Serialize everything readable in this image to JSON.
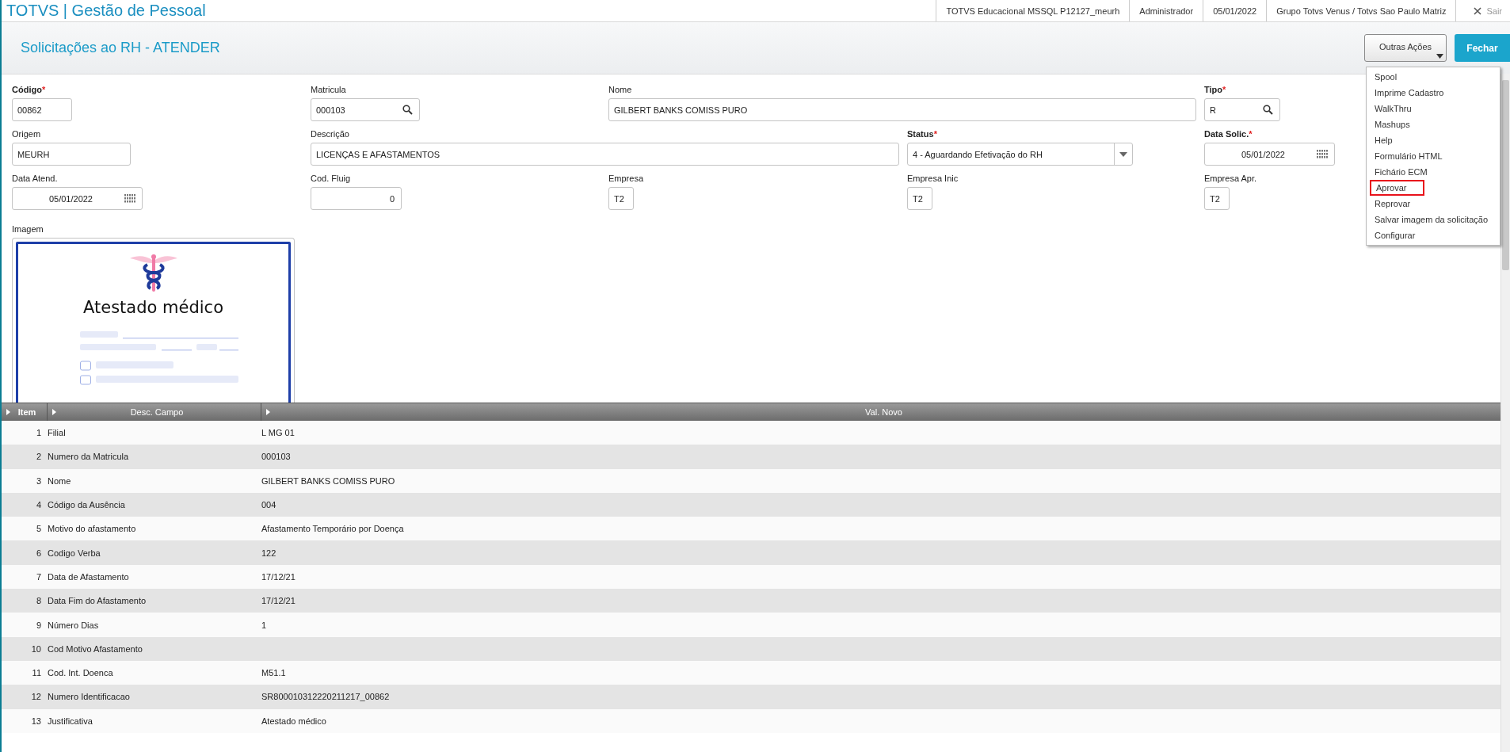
{
  "topbar": {
    "title": "TOTVS | Gestão de Pessoal",
    "info": [
      "TOTVS Educacional MSSQL P12127_meurh",
      "Administrador",
      "05/01/2022",
      "Grupo Totvs Venus / Totvs Sao Paulo Matriz"
    ],
    "exit": "Sair"
  },
  "header": {
    "title": "Solicitações ao RH - ATENDER",
    "actions_button": "Outras Ações",
    "close_button": "Fechar"
  },
  "required_mark": "*",
  "form": [
    {
      "label": "Código",
      "required": true,
      "kind": "text",
      "value": "00862"
    },
    {
      "label": "Matricula",
      "required": false,
      "kind": "search",
      "value": "000103"
    },
    {
      "label": "Nome",
      "required": false,
      "kind": "text",
      "value": "GILBERT BANKS COMISS PURO"
    },
    {
      "label": "Tipo",
      "required": true,
      "kind": "search",
      "value": "R"
    },
    {
      "label": "Origem",
      "required": false,
      "kind": "text",
      "value": "MEURH"
    },
    {
      "label": "Descrição",
      "required": false,
      "kind": "text",
      "value": "LICENÇAS E AFASTAMENTOS"
    },
    {
      "label": "Status",
      "required": true,
      "kind": "select",
      "value": "4 - Aguardando Efetivação do RH"
    },
    {
      "label": "Data Solic.",
      "required": true,
      "kind": "date",
      "value": "05/01/2022"
    },
    {
      "label": "Data Atend.",
      "required": false,
      "kind": "date",
      "value": "05/01/2022"
    },
    {
      "label": "Cod. Fluig",
      "required": false,
      "kind": "number",
      "value": "0"
    },
    {
      "label": "Empresa",
      "required": false,
      "kind": "text",
      "value": "T2"
    },
    {
      "label": "Empresa Inic",
      "required": false,
      "kind": "text",
      "value": "T2"
    },
    {
      "label": "Empresa Apr.",
      "required": false,
      "kind": "text",
      "value": "T2"
    }
  ],
  "image": {
    "label": "Imagem",
    "document_title": "Atestado médico"
  },
  "menu": [
    {
      "label": "Spool",
      "highlighted": false
    },
    {
      "label": "Imprime Cadastro",
      "highlighted": false
    },
    {
      "label": "WalkThru",
      "highlighted": false
    },
    {
      "label": "Mashups",
      "highlighted": false
    },
    {
      "label": "Help",
      "highlighted": false
    },
    {
      "label": "Formulário HTML",
      "highlighted": false
    },
    {
      "label": "Fichário ECM",
      "highlighted": false
    },
    {
      "label": "Aprovar",
      "highlighted": true
    },
    {
      "label": "Reprovar",
      "highlighted": false
    },
    {
      "label": "Salvar imagem da solicitação",
      "highlighted": false
    },
    {
      "label": "Configurar",
      "highlighted": false
    }
  ],
  "table": {
    "columns": [
      "Item",
      "Desc. Campo",
      "Val. Novo"
    ],
    "rows": [
      [
        "1",
        "Filial",
        "L MG 01"
      ],
      [
        "2",
        "Numero da Matricula",
        "000103"
      ],
      [
        "3",
        "Nome",
        "GILBERT BANKS COMISS PURO"
      ],
      [
        "4",
        "Código da Ausência",
        "004"
      ],
      [
        "5",
        "Motivo do afastamento",
        "Afastamento Temporário por Doença"
      ],
      [
        "6",
        "Codigo Verba",
        "122"
      ],
      [
        "7",
        "Data de Afastamento",
        "17/12/21"
      ],
      [
        "8",
        "Data Fim do Afastamento",
        "17/12/21"
      ],
      [
        "9",
        "Número Dias",
        "1"
      ],
      [
        "10",
        "Cod Motivo Afastamento",
        ""
      ],
      [
        "11",
        "Cod. Int. Doenca",
        "M51.1"
      ],
      [
        "12",
        "Numero Identificacao",
        "SR800010312220211217_00862"
      ],
      [
        "13",
        "Justificativa",
        "Atestado médico"
      ]
    ]
  }
}
